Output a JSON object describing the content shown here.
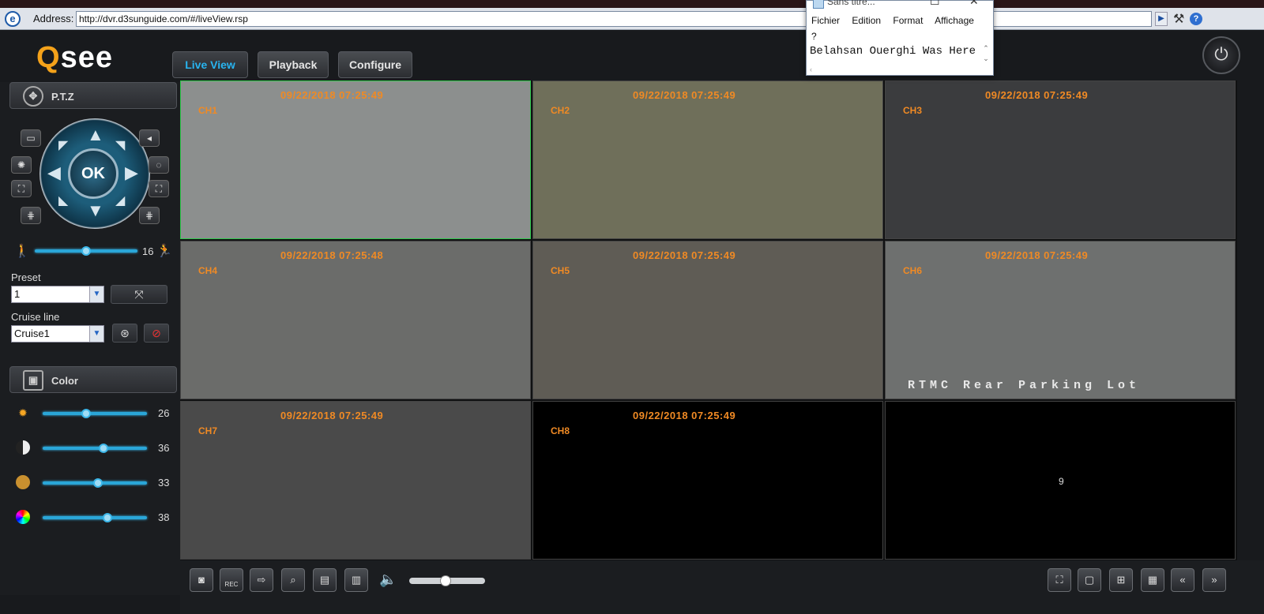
{
  "browser": {
    "address_label": "Address:",
    "url": "http://dvr.d3sunguide.com/#/liveView.rsp",
    "ie_icon": "ie-logo",
    "go_icon": "arrow-right-icon",
    "tools_icon": "tools-icon",
    "help_icon": "?"
  },
  "logo": {
    "q": "Q",
    "see": "see"
  },
  "tabs": [
    {
      "label": "Live View",
      "active": true
    },
    {
      "label": "Playback",
      "active": false
    },
    {
      "label": "Configure",
      "active": false
    }
  ],
  "ptz": {
    "header": "P.T.Z",
    "ok_label": "OK",
    "speed_value": "16",
    "speed_level": 0.5,
    "preset_label": "Preset",
    "preset_value": "1",
    "cruise_label": "Cruise line",
    "cruise_value": "Cruise1"
  },
  "color": {
    "header": "Color",
    "sliders": [
      {
        "name": "brightness",
        "value": "26",
        "level": 0.42
      },
      {
        "name": "contrast",
        "value": "36",
        "level": 0.58
      },
      {
        "name": "saturation",
        "value": "33",
        "level": 0.53
      },
      {
        "name": "hue",
        "value": "38",
        "level": 0.62
      }
    ]
  },
  "cameras": [
    {
      "channel": "CH1",
      "timestamp": "09/22/2018 07:25:49",
      "selected": true,
      "bg": "#8c8f8e"
    },
    {
      "channel": "CH2",
      "timestamp": "09/22/2018 07:25:49",
      "selected": false,
      "bg": "#6f6f5a"
    },
    {
      "channel": "CH3",
      "timestamp": "09/22/2018 07:25:49",
      "selected": false,
      "bg": "#3b3c3e"
    },
    {
      "channel": "CH4",
      "timestamp": "09/22/2018 07:25:48",
      "selected": false,
      "bg": "#6b6c6a"
    },
    {
      "channel": "CH5",
      "timestamp": "09/22/2018 07:25:49",
      "selected": false,
      "bg": "#5f5c55"
    },
    {
      "channel": "CH6",
      "timestamp": "09/22/2018 07:25:49",
      "selected": false,
      "bg": "#6e706f",
      "overlay": "RTMC Rear Parking Lot"
    },
    {
      "channel": "CH7",
      "timestamp": "09/22/2018 07:25:49",
      "selected": false,
      "bg": "#4a4a4a"
    },
    {
      "channel": "CH8",
      "timestamp": "09/22/2018 07:25:49",
      "selected": false,
      "bg": "#000000"
    },
    {
      "channel": "9",
      "timestamp": "",
      "selected": false,
      "bg": "#000000"
    }
  ],
  "bottom_left_buttons": [
    "snapshot-icon",
    "rec-icon",
    "export-icon",
    "search-icon",
    "screen-icon",
    "record-file-icon"
  ],
  "rec_label": "REC",
  "volume_level": 0.48,
  "bottom_right_buttons": [
    "fullscreen-icon",
    "single-view-icon",
    "quad-view-icon",
    "nine-view-icon",
    "previous-page-icon",
    "next-page-icon"
  ],
  "notepad": {
    "title": "Sans titre...",
    "menu": [
      "Fichier",
      "Edition",
      "Format",
      "Affichage"
    ],
    "menu_q": "?",
    "text": "Belahsan Ouerghi Was Here"
  }
}
